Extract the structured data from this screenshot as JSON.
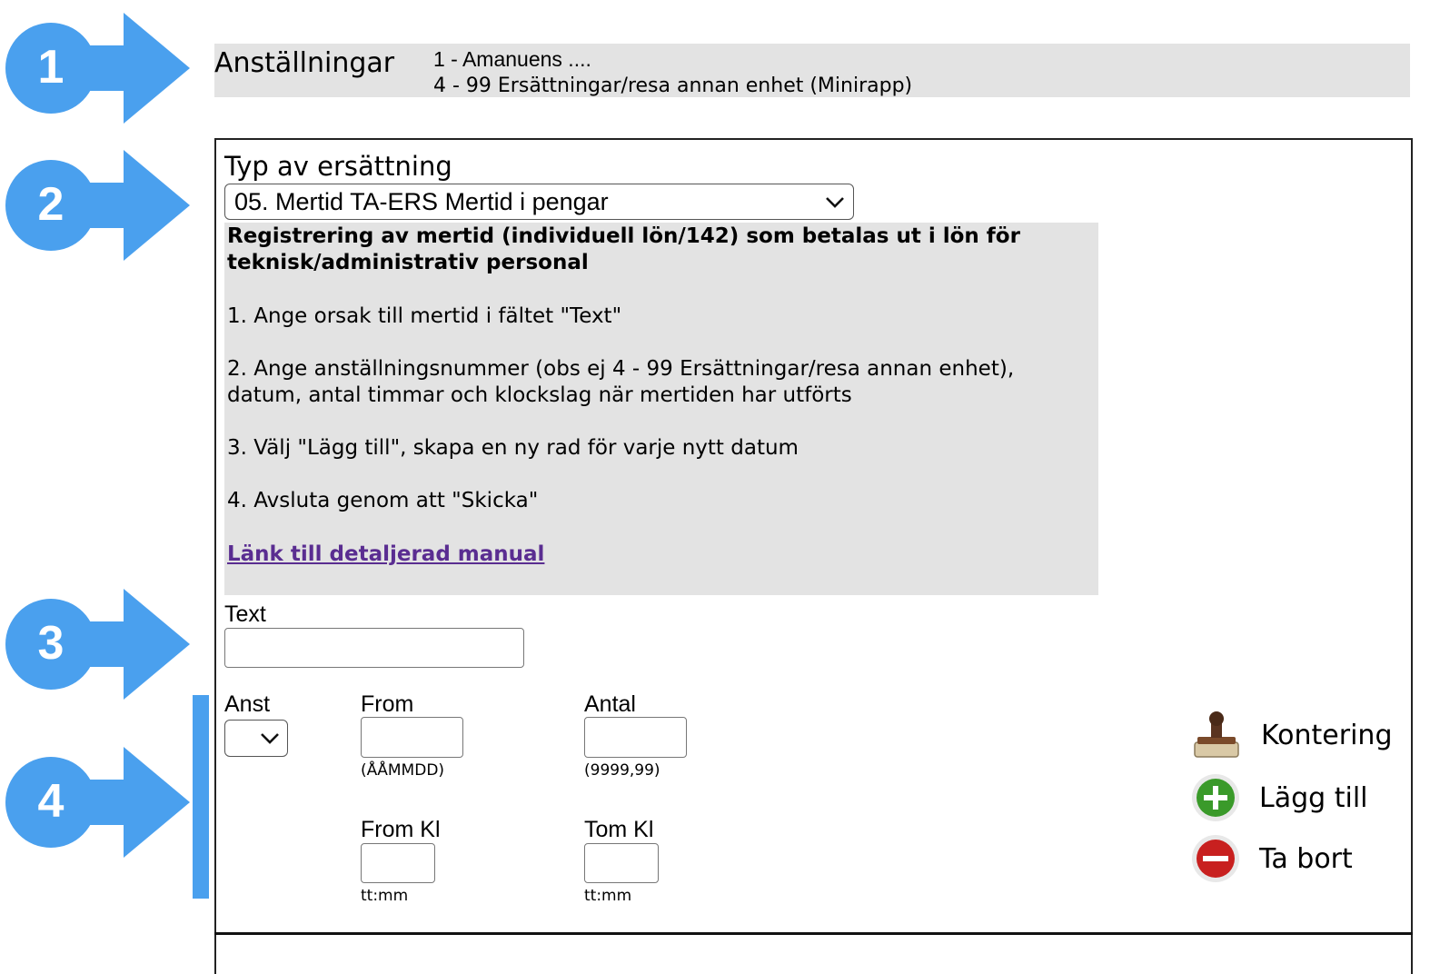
{
  "markers": [
    {
      "number": "1"
    },
    {
      "number": "2"
    },
    {
      "number": "3"
    },
    {
      "number": "4"
    }
  ],
  "employment": {
    "label": "Anställningar",
    "items": [
      "1 - Amanuens ....",
      "4 - 99 Ersättningar/resa annan enhet (Minirapp)"
    ]
  },
  "compensation": {
    "label": "Typ av ersättning",
    "selected": "05. Mertid TA-ERS Mertid i pengar"
  },
  "info": {
    "heading": "Registrering av mertid (individuell lön/142) som betalas ut i lön för teknisk/administrativ personal",
    "steps": [
      "1. Ange orsak till mertid i fältet \"Text\"",
      "2. Ange anställningsnummer (obs ej 4 - 99 Ersättningar/resa annan enhet), datum, antal timmar och klockslag när mertiden har utförts",
      "3. Välj \"Lägg till\", skapa en ny rad för varje nytt datum",
      "4. Avsluta genom att \"Skicka\""
    ],
    "link": "Länk till detaljerad manual"
  },
  "form": {
    "text_label": "Text",
    "text_value": "",
    "anst_label": "Anst",
    "from_label": "From",
    "from_hint": "(ÅÅMMDD)",
    "antal_label": "Antal",
    "antal_hint": "(9999,99)",
    "fromkl_label": "From Kl",
    "fromkl_hint": "tt:mm",
    "tomkl_label": "Tom Kl",
    "tomkl_hint": "tt:mm"
  },
  "actions": {
    "kontering": "Kontering",
    "add": "Lägg till",
    "remove": "Ta bort"
  },
  "colors": {
    "marker_blue": "#4aa0ee",
    "panel_gray": "#e3e3e3",
    "link_purple": "#5a2d91",
    "add_green": "#3a9a2a",
    "remove_red": "#c8201f"
  }
}
